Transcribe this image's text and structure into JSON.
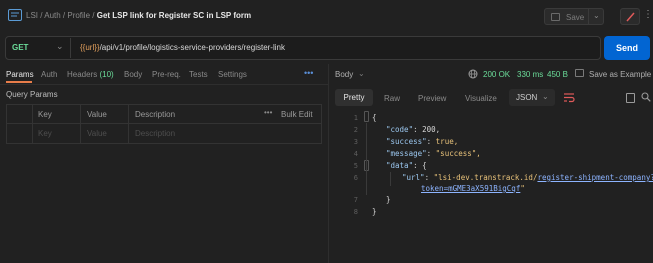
{
  "header": {
    "crumb_pre": "LSI / Auth / Profile /",
    "request_name": "Get LSP link for Register SC in LSP form",
    "save_label": "Save"
  },
  "request": {
    "method": "GET",
    "url_var": "{{url}}",
    "url_path": "/api/v1/profile/logistics-service-providers/register-link",
    "send_label": "Send"
  },
  "req_tabs": {
    "params": "Params",
    "auth": "Auth",
    "headers": "Headers",
    "headers_count": "(10)",
    "body": "Body",
    "prereq": "Pre-req.",
    "tests": "Tests",
    "settings": "Settings"
  },
  "query_params": {
    "title": "Query Params",
    "columns": [
      "Key",
      "Value",
      "Description"
    ],
    "placeholders": [
      "Key",
      "Value",
      "Description"
    ],
    "bulk_edit": "Bulk Edit"
  },
  "response": {
    "body_label": "Body",
    "status": "200 OK",
    "time": "330 ms",
    "size": "450 B",
    "save_example": "Save as Example",
    "tabs": [
      "Pretty",
      "Raw",
      "Preview",
      "Visualize"
    ],
    "format": "JSON",
    "line_numbers": [
      "1",
      "2",
      "3",
      "4",
      "5",
      "6",
      "7",
      "8"
    ],
    "code": {
      "l1": "{",
      "code_key": "\"code\"",
      "code_val": "200,",
      "success_key": "\"success\"",
      "success_val": "true,",
      "message_key": "\"message\"",
      "message_val": "\"success\",",
      "data_key": "\"data\"",
      "data_open": "{",
      "url_key": "\"url\"",
      "url_val_a": "\"lsi-dev.transtrack.id/",
      "url_link_a": "register-shipment-company?",
      "url_link_b": "token=mGME3aX591BigCqf",
      "url_val_b": "\"",
      "close_inner": "}",
      "close_outer": "}"
    }
  },
  "colors": {
    "accent": "#0265d2",
    "get_method": "#6bdd9a",
    "status_ok": "#6bdd9a",
    "tab_underline": "#e87d4a",
    "url_variable": "#e3a05c"
  }
}
